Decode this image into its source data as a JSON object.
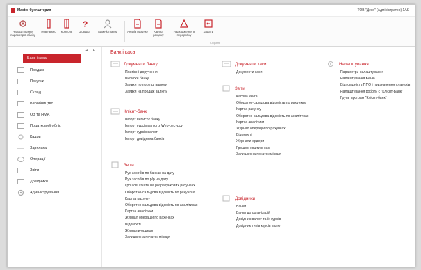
{
  "titlebar": {
    "app": "Master бухгалтерия",
    "org": "ТОВ \"Деко\" (Адміністратор) 1AS"
  },
  "toolbar": {
    "buttons": [
      {
        "label": "Налаштування параметрів обліку"
      },
      {
        "label": "Нове вікно"
      },
      {
        "label": "Консоль"
      },
      {
        "label": "Довідка"
      },
      {
        "label": "Адміністратор"
      },
      {
        "label": "Аналіз рахунку"
      },
      {
        "label": "Картка рахунку"
      },
      {
        "label": "Надходження в переробку"
      },
      {
        "label": "Додати"
      }
    ],
    "group_label": "Обране"
  },
  "sidebar": {
    "items": [
      {
        "label": "Банк і каса"
      },
      {
        "label": "Продажі"
      },
      {
        "label": "Покупки"
      },
      {
        "label": "Склад"
      },
      {
        "label": "Виробництво"
      },
      {
        "label": "ОЗ та НМА"
      },
      {
        "label": "Податковий облік"
      },
      {
        "label": "Кадри"
      },
      {
        "label": "Зарплата"
      },
      {
        "label": "Операції"
      },
      {
        "label": "Звіти"
      },
      {
        "label": "Довідники"
      },
      {
        "label": "Адміністрування"
      }
    ]
  },
  "main": {
    "title": "Банк і каса",
    "sections": {
      "bank_docs": {
        "title": "Документи банку",
        "links": [
          "Платіжні доручення",
          "Виписки банку",
          "Заявки по покупці валюти",
          "Заявки на продаж валюти"
        ]
      },
      "client_bank": {
        "title": "Клієнт-банк",
        "links": [
          "Імпорт виписок банку",
          "Імпорт курсів валют з Web-ресурсу",
          "Імпорт курсів валют",
          "Імпорт довідника банків"
        ]
      },
      "reports_left": {
        "title": "Звіти",
        "links": [
          "Рух засобів по банках на дату",
          "Рух засобів по р/р на дату",
          "Грошові кошти на розрахункових рахунках",
          "Оборотно-сальдова відомість по рахунках",
          "Картка рахунку",
          "Оборотно-сальдова відомість по аналітиках",
          "Картка аналітики",
          "Журнал операцій по рахунках",
          "Відомості",
          "Журнали-ордери",
          "Залишки на початок місяця"
        ]
      },
      "cash_docs": {
        "title": "Документи каси",
        "links": [
          "Документи каси"
        ]
      },
      "reports_mid": {
        "title": "Звіти",
        "links": [
          "Касова книга",
          "Оборотно-сальдова відомість по рахунках",
          "Картка рахунку",
          "Оборотно-сальдова відомість по аналітиках",
          "Картка аналітики",
          "Журнал операцій по рахунках",
          "Відомості",
          "Журнали-ордери",
          "Грошові кошти в касі",
          "Залишки на початок місяця"
        ]
      },
      "directories": {
        "title": "Довідники",
        "links": [
          "Банки",
          "Банки до організацій",
          "Довідник валют та їх курсів",
          "Довідник типів курсів валют"
        ]
      },
      "settings": {
        "title": "Налаштування",
        "links": [
          "Параметри налаштування",
          "Налаштування меню",
          "Відповідність ППО і призначення платежів",
          "Налаштування роботи с \"Клієнт-Банк\"",
          "Групи програм \"Клієнт-банк\""
        ]
      }
    }
  },
  "colors": {
    "accent": "#c9252c"
  }
}
